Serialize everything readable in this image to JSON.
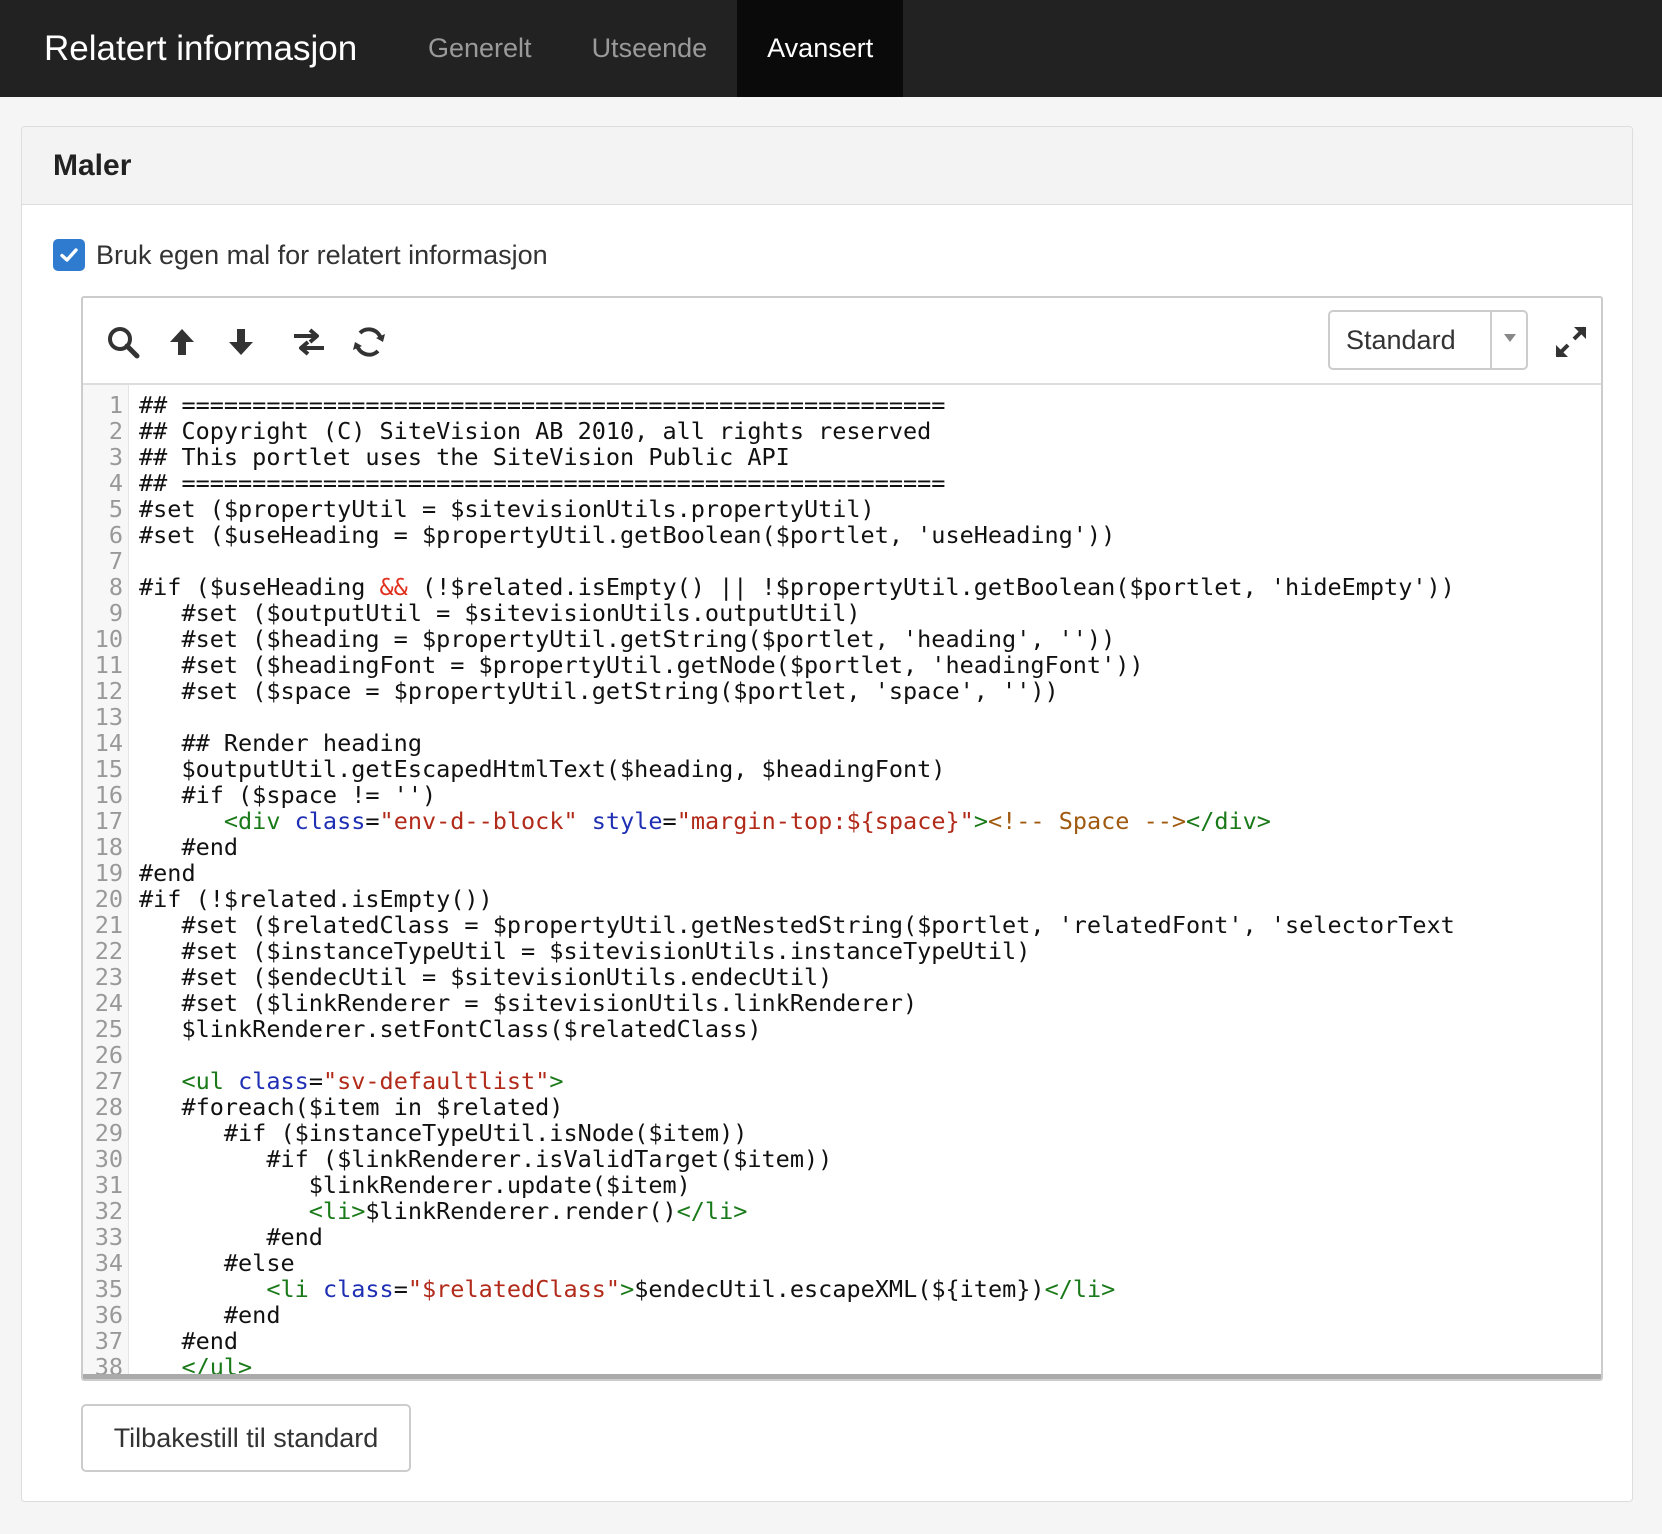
{
  "header": {
    "title": "Relatert informasjon",
    "tabs": [
      {
        "label": "Generelt",
        "active": false
      },
      {
        "label": "Utseende",
        "active": false
      },
      {
        "label": "Avansert",
        "active": true
      }
    ]
  },
  "panel": {
    "title": "Maler",
    "checkbox_label": "Bruk egen mal for relatert informasjon",
    "checkbox_checked": true
  },
  "editor": {
    "toolbar_icons": [
      "search-icon",
      "arrow-up-icon",
      "arrow-down-icon",
      "swap-icon",
      "refresh-icon",
      "expand-icon"
    ],
    "mode_value": "Standard",
    "lines": [
      [
        [
          "t",
          "## ======================================================"
        ]
      ],
      [
        [
          "t",
          "## Copyright (C) SiteVision AB 2010, all rights reserved"
        ]
      ],
      [
        [
          "t",
          "## This portlet uses the SiteVision Public API"
        ]
      ],
      [
        [
          "t",
          "## ======================================================"
        ]
      ],
      [
        [
          "t",
          "#set ($propertyUtil = $sitevisionUtils.propertyUtil)"
        ]
      ],
      [
        [
          "t",
          "#set ($useHeading = $propertyUtil.getBoolean($portlet, 'useHeading'))"
        ]
      ],
      [
        [
          "t",
          ""
        ]
      ],
      [
        [
          "t",
          "#if ($useHeading "
        ],
        [
          "op",
          "&&"
        ],
        [
          "t",
          " (!$related.isEmpty() || !$propertyUtil.getBoolean($portlet, 'hideEmpty'))"
        ]
      ],
      [
        [
          "t",
          "   #set ($outputUtil = $sitevisionUtils.outputUtil)"
        ]
      ],
      [
        [
          "t",
          "   #set ($heading = $propertyUtil.getString($portlet, 'heading', ''))"
        ]
      ],
      [
        [
          "t",
          "   #set ($headingFont = $propertyUtil.getNode($portlet, 'headingFont'))"
        ]
      ],
      [
        [
          "t",
          "   #set ($space = $propertyUtil.getString($portlet, 'space', ''))"
        ]
      ],
      [
        [
          "t",
          ""
        ]
      ],
      [
        [
          "t",
          "   ## Render heading"
        ]
      ],
      [
        [
          "t",
          "   $outputUtil.getEscapedHtmlText($heading, $headingFont)"
        ]
      ],
      [
        [
          "t",
          "   #if ($space != '')"
        ]
      ],
      [
        [
          "t",
          "      "
        ],
        [
          "tag",
          "<div"
        ],
        [
          "t",
          " "
        ],
        [
          "attr",
          "class"
        ],
        [
          "t",
          "="
        ],
        [
          "str",
          "\"env-d--block\""
        ],
        [
          "t",
          " "
        ],
        [
          "attr",
          "style"
        ],
        [
          "t",
          "="
        ],
        [
          "str",
          "\"margin-top:${space}\""
        ],
        [
          "tag",
          ">"
        ],
        [
          "com",
          "<!-- Space -->"
        ],
        [
          "tag",
          "</div>"
        ]
      ],
      [
        [
          "t",
          "   #end"
        ]
      ],
      [
        [
          "t",
          "#end"
        ]
      ],
      [
        [
          "t",
          "#if (!$related.isEmpty())"
        ]
      ],
      [
        [
          "t",
          "   #set ($relatedClass = $propertyUtil.getNestedString($portlet, 'relatedFont', 'selectorText"
        ]
      ],
      [
        [
          "t",
          "   #set ($instanceTypeUtil = $sitevisionUtils.instanceTypeUtil)"
        ]
      ],
      [
        [
          "t",
          "   #set ($endecUtil = $sitevisionUtils.endecUtil)"
        ]
      ],
      [
        [
          "t",
          "   #set ($linkRenderer = $sitevisionUtils.linkRenderer)"
        ]
      ],
      [
        [
          "t",
          "   $linkRenderer.setFontClass($relatedClass)"
        ]
      ],
      [
        [
          "t",
          ""
        ]
      ],
      [
        [
          "t",
          "   "
        ],
        [
          "tag",
          "<ul"
        ],
        [
          "t",
          " "
        ],
        [
          "attr",
          "class"
        ],
        [
          "t",
          "="
        ],
        [
          "str",
          "\"sv-defaultlist\""
        ],
        [
          "tag",
          ">"
        ]
      ],
      [
        [
          "t",
          "   #foreach($item in $related)"
        ]
      ],
      [
        [
          "t",
          "      #if ($instanceTypeUtil.isNode($item))"
        ]
      ],
      [
        [
          "t",
          "         #if ($linkRenderer.isValidTarget($item))"
        ]
      ],
      [
        [
          "t",
          "            $linkRenderer.update($item)"
        ]
      ],
      [
        [
          "t",
          "            "
        ],
        [
          "tag",
          "<li>"
        ],
        [
          "t",
          "$linkRenderer.render()"
        ],
        [
          "tag",
          "</li>"
        ]
      ],
      [
        [
          "t",
          "         #end"
        ]
      ],
      [
        [
          "t",
          "      #else"
        ]
      ],
      [
        [
          "t",
          "         "
        ],
        [
          "tag",
          "<li"
        ],
        [
          "t",
          " "
        ],
        [
          "attr",
          "class"
        ],
        [
          "t",
          "="
        ],
        [
          "str",
          "\"$relatedClass\""
        ],
        [
          "tag",
          ">"
        ],
        [
          "t",
          "$endecUtil.escapeXML(${item})"
        ],
        [
          "tag",
          "</li>"
        ]
      ],
      [
        [
          "t",
          "      #end"
        ]
      ],
      [
        [
          "t",
          "   #end"
        ]
      ],
      [
        [
          "t",
          "   "
        ],
        [
          "tag",
          "</ul>"
        ]
      ]
    ]
  },
  "reset_button": "Tilbakestill til standard",
  "colors": {
    "topbar": "#222222",
    "active_tab": "#0a0a0a",
    "checkbox": "#2e7bd0",
    "code_tag": "#1a7a1a",
    "code_attr": "#1f2fb3",
    "code_string": "#b12a1a",
    "code_operator": "#e0301e",
    "code_comment": "#a05a10"
  }
}
